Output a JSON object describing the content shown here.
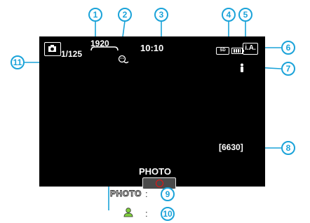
{
  "screen": {
    "resolution": "1920",
    "shutter_speed": "1/125",
    "clock": "10:10",
    "remaining_shots": "[6630]",
    "media_label": "SD",
    "ia_label": "i.A.",
    "photo_label": "PHOTO"
  },
  "callouts": [
    "1",
    "2",
    "3",
    "4",
    "5",
    "6",
    "7",
    "8",
    "9",
    "10",
    "11"
  ],
  "legend": {
    "photo_text": "PHOTO",
    "colon_1": ":",
    "colon_2": ":"
  },
  "colors": {
    "callout": "#1ba3d9",
    "record_button_ring": "#e11111",
    "screen_background": "#000000"
  }
}
